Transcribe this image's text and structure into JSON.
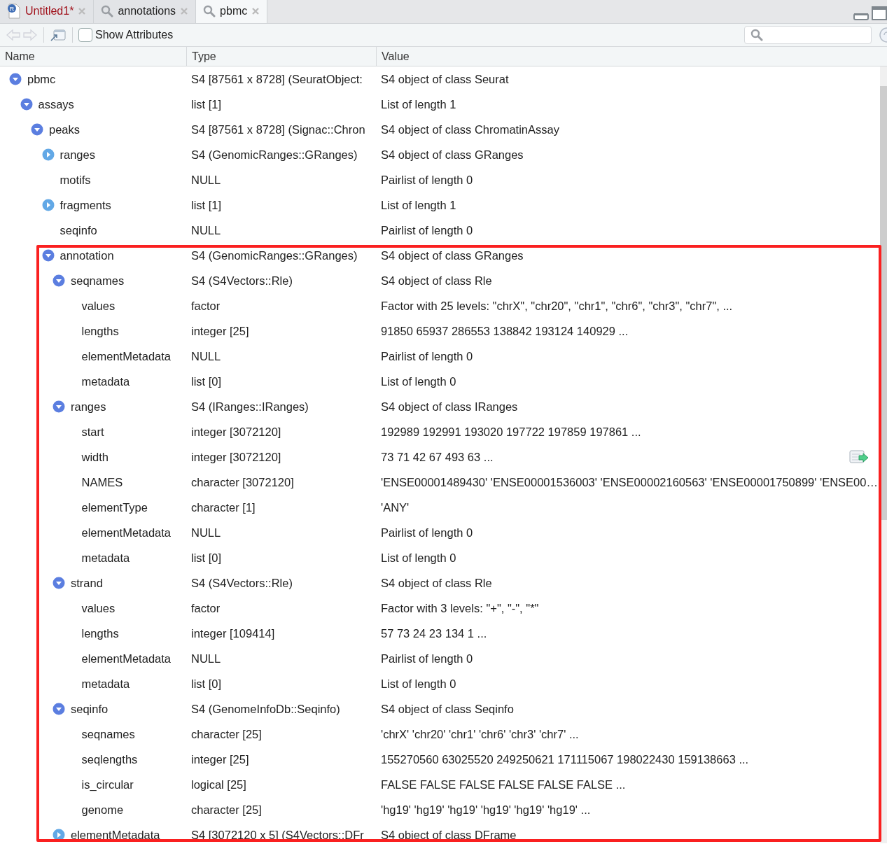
{
  "tabs": [
    {
      "kind": "script",
      "icon_text": "R",
      "label": "Untitled1*",
      "modified": true,
      "selected": false
    },
    {
      "kind": "viewer",
      "label": "annotations",
      "modified": false,
      "selected": false
    },
    {
      "kind": "viewer",
      "label": "pbmc",
      "modified": false,
      "selected": true
    }
  ],
  "toolbar": {
    "back_disabled": true,
    "forward_disabled": true,
    "show_attributes": {
      "label": "Show Attributes",
      "checked": false
    }
  },
  "columns": [
    "Name",
    "Type",
    "Value"
  ],
  "tree": [
    {
      "kind": "node",
      "name": "pbmc",
      "type": "S4 [87561 x 8728] (SeuratObject:",
      "value": "S4 object of class Seurat",
      "expanded": true,
      "children": [
        {
          "kind": "node",
          "name": "assays",
          "type": "list [1]",
          "value": "List of length 1",
          "expanded": true,
          "children": [
            {
              "kind": "node",
              "name": "peaks",
              "type": "S4 [87561 x 8728] (Signac::Chron",
              "value": "S4 object of class ChromatinAssay",
              "expanded": true,
              "children": [
                {
                  "kind": "node",
                  "name": "ranges",
                  "type": "S4 (GenomicRanges::GRanges)",
                  "value": "S4 object of class GRanges",
                  "expanded": false
                },
                {
                  "kind": "leaf",
                  "name": "motifs",
                  "type": "NULL",
                  "value": "Pairlist of length 0"
                },
                {
                  "kind": "node",
                  "name": "fragments",
                  "type": "list [1]",
                  "value": "List of length 1",
                  "expanded": false
                },
                {
                  "kind": "leaf",
                  "name": "seqinfo",
                  "type": "NULL",
                  "value": "Pairlist of length 0"
                },
                {
                  "kind": "node",
                  "name": "annotation",
                  "type": "S4 (GenomicRanges::GRanges)",
                  "value": "S4 object of class GRanges",
                  "expanded": true,
                  "highlighted": true,
                  "children": [
                    {
                      "kind": "node",
                      "name": "seqnames",
                      "type": "S4 (S4Vectors::Rle)",
                      "value": "S4 object of class Rle",
                      "expanded": true,
                      "children": [
                        {
                          "kind": "leaf",
                          "name": "values",
                          "type": "factor",
                          "value": "Factor with 25 levels: \"chrX\", \"chr20\", \"chr1\", \"chr6\", \"chr3\", \"chr7\", ..."
                        },
                        {
                          "kind": "leaf",
                          "name": "lengths",
                          "type": "integer [25]",
                          "value": "91850 65937 286553 138842 193124 140929 ..."
                        },
                        {
                          "kind": "leaf",
                          "name": "elementMetadata",
                          "type": "NULL",
                          "value": "Pairlist of length 0"
                        },
                        {
                          "kind": "leaf",
                          "name": "metadata",
                          "type": "list [0]",
                          "value": "List of length 0"
                        }
                      ]
                    },
                    {
                      "kind": "node",
                      "name": "ranges",
                      "type": "S4 (IRanges::IRanges)",
                      "value": "S4 object of class IRanges",
                      "expanded": true,
                      "children": [
                        {
                          "kind": "leaf",
                          "name": "start",
                          "type": "integer [3072120]",
                          "value": "192989 192991 193020 197722 197859 197861 ..."
                        },
                        {
                          "kind": "leaf",
                          "name": "width",
                          "type": "integer [3072120]",
                          "value": "73 71 42 67 493 63 ...",
                          "viewer": true
                        },
                        {
                          "kind": "leaf",
                          "name": "NAMES",
                          "type": "character [3072120]",
                          "value": "'ENSE00001489430' 'ENSE00001536003' 'ENSE00002160563' 'ENSE00001750899' 'ENSE00…"
                        },
                        {
                          "kind": "leaf",
                          "name": "elementType",
                          "type": "character [1]",
                          "value": "'ANY'"
                        },
                        {
                          "kind": "leaf",
                          "name": "elementMetadata",
                          "type": "NULL",
                          "value": "Pairlist of length 0"
                        },
                        {
                          "kind": "leaf",
                          "name": "metadata",
                          "type": "list [0]",
                          "value": "List of length 0"
                        }
                      ]
                    },
                    {
                      "kind": "node",
                      "name": "strand",
                      "type": "S4 (S4Vectors::Rle)",
                      "value": "S4 object of class Rle",
                      "expanded": true,
                      "children": [
                        {
                          "kind": "leaf",
                          "name": "values",
                          "type": "factor",
                          "value": "Factor with 3 levels: \"+\", \"-\", \"*\""
                        },
                        {
                          "kind": "leaf",
                          "name": "lengths",
                          "type": "integer [109414]",
                          "value": "57 73 24 23 134 1 ..."
                        },
                        {
                          "kind": "leaf",
                          "name": "elementMetadata",
                          "type": "NULL",
                          "value": "Pairlist of length 0"
                        },
                        {
                          "kind": "leaf",
                          "name": "metadata",
                          "type": "list [0]",
                          "value": "List of length 0"
                        }
                      ]
                    },
                    {
                      "kind": "node",
                      "name": "seqinfo",
                      "type": "S4 (GenomeInfoDb::Seqinfo)",
                      "value": "S4 object of class Seqinfo",
                      "expanded": true,
                      "children": [
                        {
                          "kind": "leaf",
                          "name": "seqnames",
                          "type": "character [25]",
                          "value": "'chrX' 'chr20' 'chr1' 'chr6' 'chr3' 'chr7' ..."
                        },
                        {
                          "kind": "leaf",
                          "name": "seqlengths",
                          "type": "integer [25]",
                          "value": "155270560 63025520 249250621 171115067 198022430 159138663 ..."
                        },
                        {
                          "kind": "leaf",
                          "name": "is_circular",
                          "type": "logical [25]",
                          "value": "FALSE FALSE FALSE FALSE FALSE FALSE ..."
                        },
                        {
                          "kind": "leaf",
                          "name": "genome",
                          "type": "character [25]",
                          "value": "'hg19' 'hg19' 'hg19' 'hg19' 'hg19' 'hg19' ..."
                        }
                      ]
                    },
                    {
                      "kind": "node",
                      "name": "elementMetadata",
                      "type": "S4 [3072120 x 5] (S4Vectors::DFr",
                      "value": "S4 object of class DFrame",
                      "expanded": false
                    }
                  ]
                }
              ]
            }
          ]
        }
      ]
    }
  ]
}
